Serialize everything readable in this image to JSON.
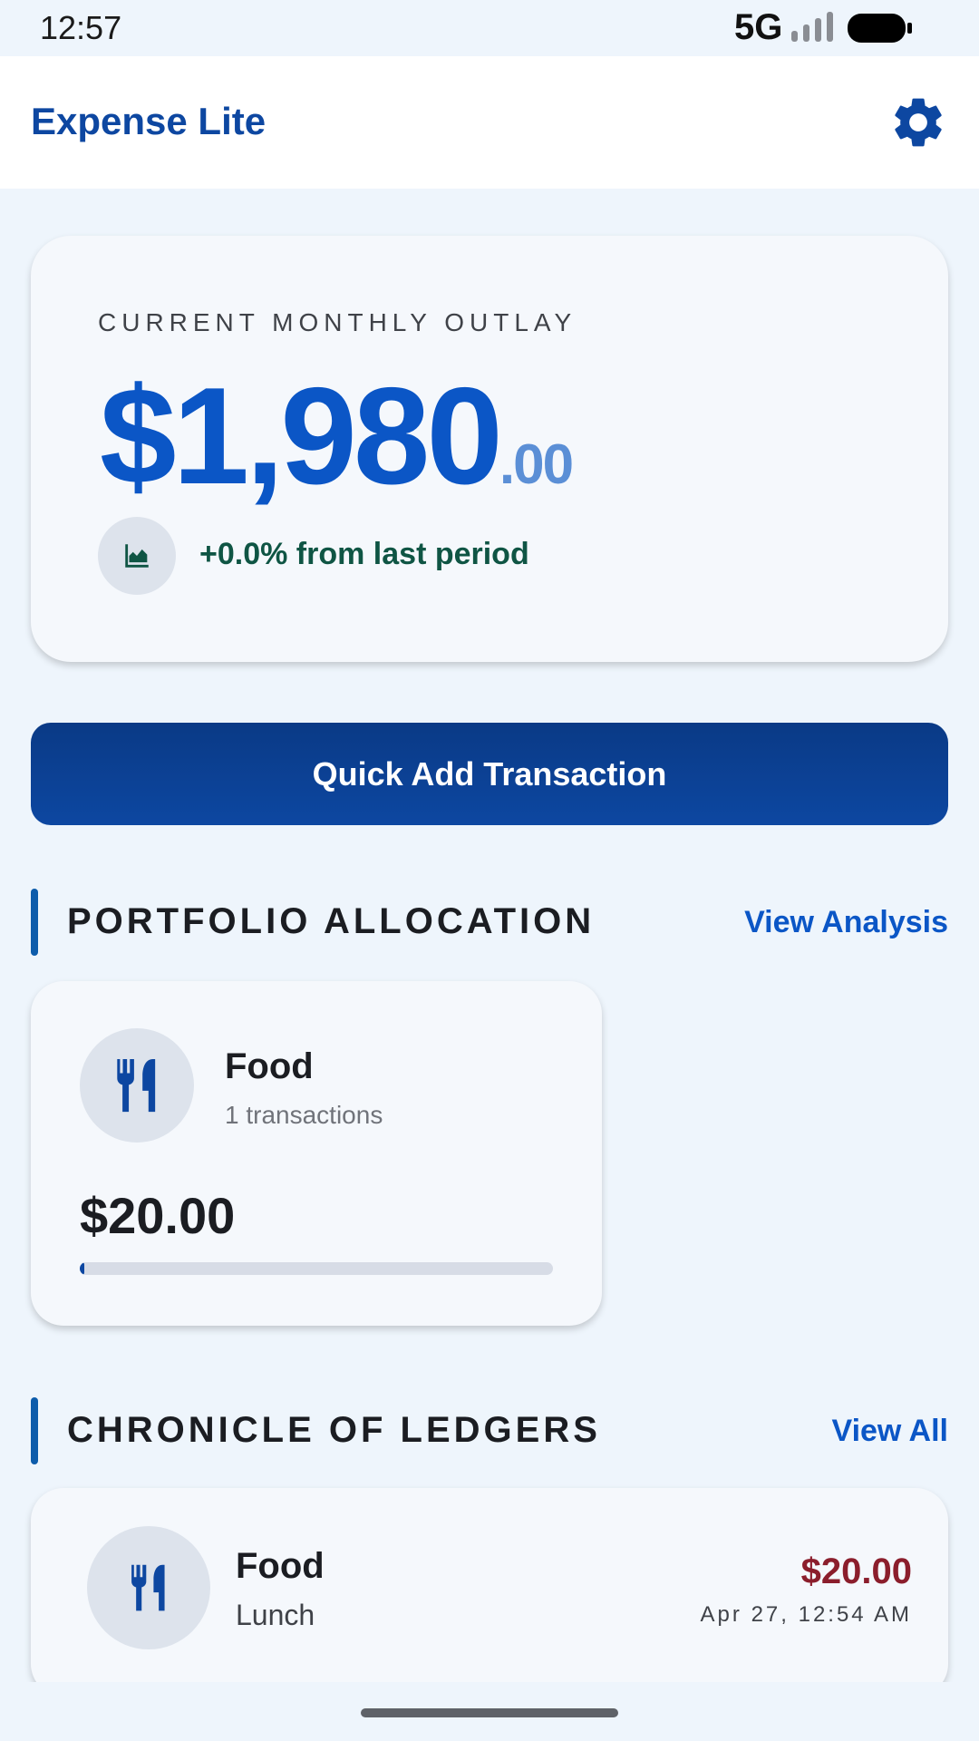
{
  "status_bar": {
    "time": "12:57",
    "network": "5G"
  },
  "app_bar": {
    "title": "Expense Lite",
    "settings_icon": "gear-icon"
  },
  "summary": {
    "label": "CURRENT MONTHLY OUTLAY",
    "amount_main": "$1,980",
    "amount_cents": ".00",
    "trend_icon": "area-chart-icon",
    "trend_text": "+0.0% from last period"
  },
  "quick_add": {
    "label": "Quick Add Transaction"
  },
  "allocation": {
    "title": "PORTFOLIO ALLOCATION",
    "link": "View Analysis",
    "items": [
      {
        "icon": "utensils-icon",
        "name": "Food",
        "count": "1 transactions",
        "amount": "$20.00",
        "progress": 0.01
      }
    ]
  },
  "ledgers": {
    "title": "CHRONICLE OF LEDGERS",
    "link": "View All",
    "items": [
      {
        "icon": "utensils-icon",
        "category": "Food",
        "note": "Lunch",
        "amount": "$20.00",
        "date": "Apr 27, 12:54 AM"
      }
    ]
  },
  "colors": {
    "accent": "#0d47a1",
    "amount_blue": "#0b56c6",
    "positive": "#0f5544",
    "expense": "#8b1e2c",
    "background": "#eef5fc"
  }
}
